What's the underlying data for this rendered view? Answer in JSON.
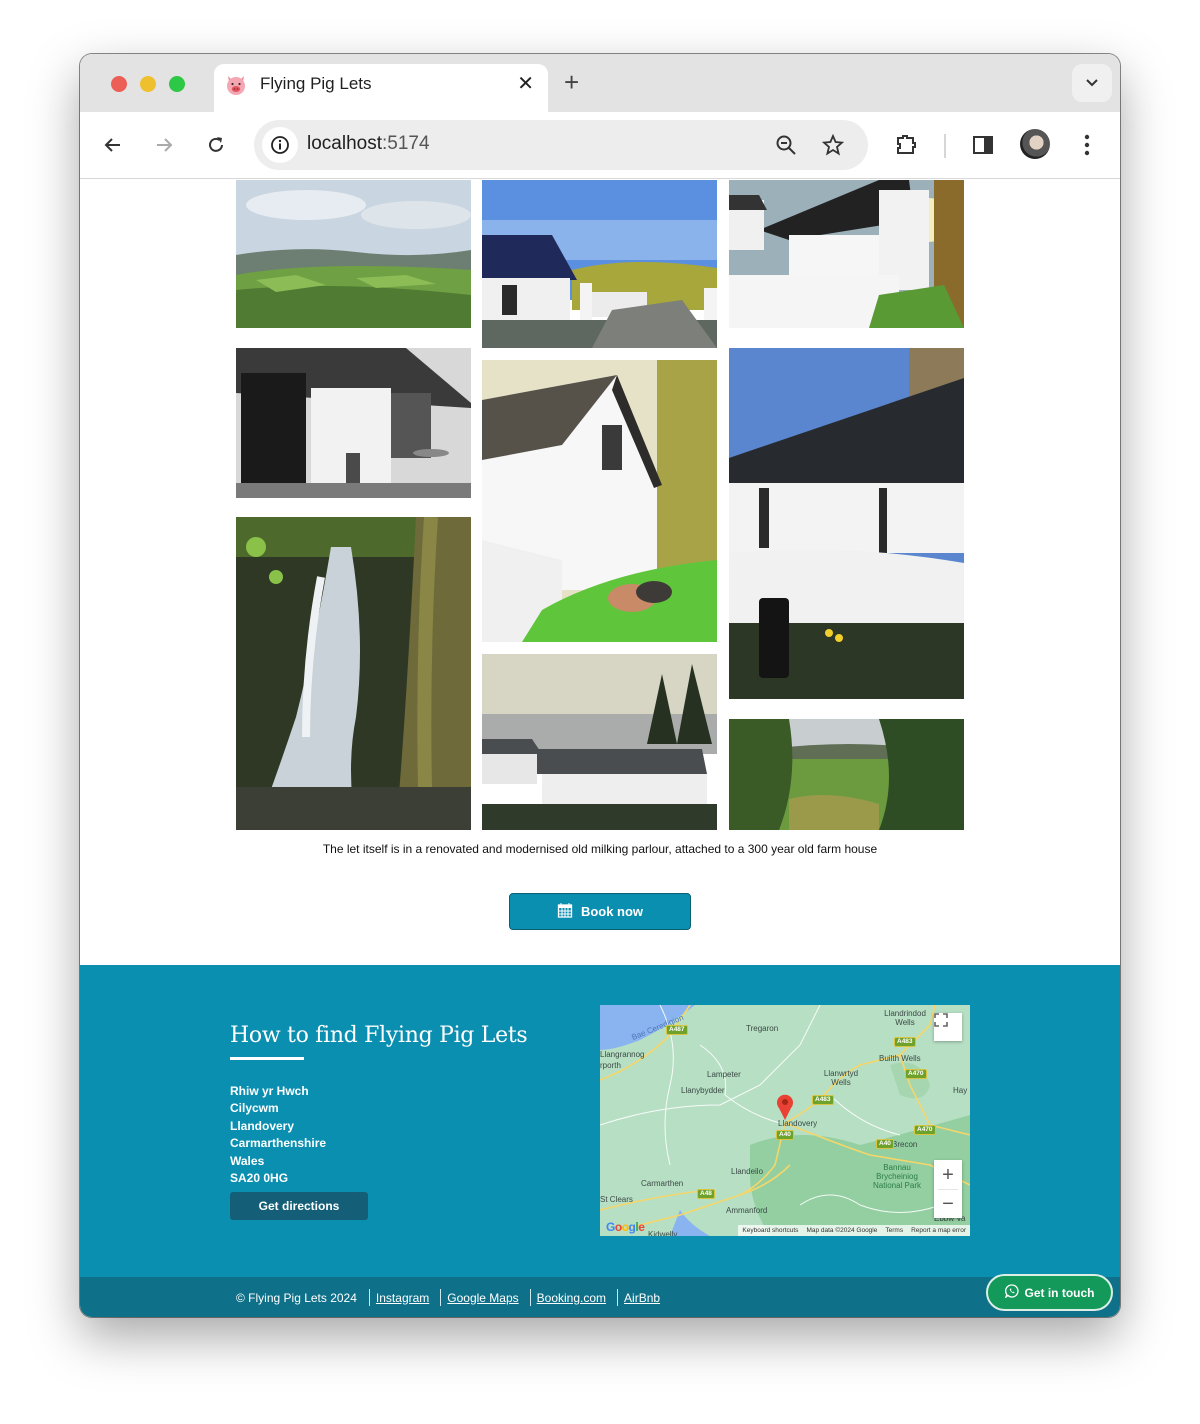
{
  "browser": {
    "tab_title": "Flying Pig Lets",
    "favicon": "pig-face-icon",
    "url_host": "localhost",
    "url_port": ":5174",
    "icons": [
      "back-arrow-icon",
      "forward-arrow-icon",
      "reload-icon",
      "site-info-icon",
      "zoom-out-icon",
      "bookmark-star-icon",
      "extensions-puzzle-icon",
      "side-panel-icon",
      "profile-avatar",
      "more-menu-icon",
      "tab-search-chevron-icon",
      "close-tab-icon",
      "new-tab-plus-icon"
    ]
  },
  "gallery": {
    "photos": [
      {
        "alt": "Green valley landscape with rolling fields"
      },
      {
        "alt": "Cottage with slate roof and white gate under blue sky"
      },
      {
        "alt": "White cottage at sunset with garden wall"
      },
      {
        "alt": "Black and white patio with door and milk churn"
      },
      {
        "alt": "Whitewashed gable end with pigs grazing on grass"
      },
      {
        "alt": "Long whitewashed cottage with skylights and milk churn"
      },
      {
        "alt": "Woodland stream waterfall with mossy tree"
      },
      {
        "alt": "Cottages at dawn with misty valley"
      },
      {
        "alt": "View of green countryside through trees"
      }
    ],
    "caption": "The let itself is in a renovated and modernised old milking parlour, attached to a 300 year old farm house"
  },
  "book_button": {
    "label": "Book now",
    "icon": "calendar-icon"
  },
  "find": {
    "title": "How to find Flying Pig Lets",
    "address": [
      "Rhiw yr Hwch",
      "Cilycwm",
      "Llandovery",
      "Carmarthenshire",
      "Wales",
      "SA20 0HG"
    ],
    "directions_label": "Get directions"
  },
  "map": {
    "places": [
      "Bae Ceredigion",
      "Tregaron",
      "Llandrindod Wells",
      "Llangrannog",
      "rporth",
      "Lampeter",
      "Llanybydder",
      "Llanwrtyd Wells",
      "Builth Wells",
      "Hay",
      "Llandovery",
      "Brecon",
      "Bannau Brycheiniog National Park",
      "Llandeilo",
      "Carmarthen",
      "St Clears",
      "Ammanford",
      "Kidwelly",
      "Ebbw Va"
    ],
    "roads": [
      "A487",
      "A483",
      "A483",
      "A470",
      "A40",
      "A40",
      "A470",
      "A48"
    ],
    "attribution": [
      "Keyboard shortcuts",
      "Map data ©2024 Google",
      "Terms",
      "Report a map error"
    ],
    "logo": "Google",
    "zoom_in": "+",
    "zoom_out": "−",
    "accent_pin": "#e94235"
  },
  "footer": {
    "copyright": "© Flying Pig Lets 2024",
    "links": [
      "Instagram",
      "Google Maps",
      "Booking.com",
      "AirBnb"
    ],
    "contact_label": "Get in touch",
    "contact_icon": "whatsapp-icon"
  },
  "colors": {
    "brand_teal": "#0b8fb0",
    "footer_teal": "#0f7189",
    "button_dark": "#145f77",
    "whatsapp_green": "#139a5a"
  }
}
